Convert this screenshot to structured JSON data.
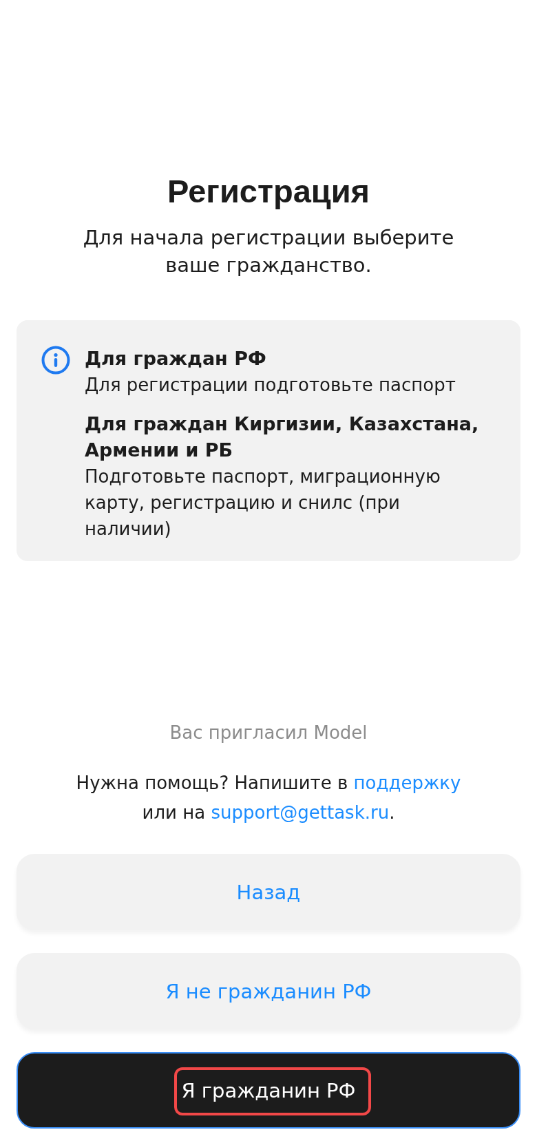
{
  "header": {
    "title": "Регистрация",
    "subtitle": "Для начала регистрации выберите ваше гражданство."
  },
  "info_card": {
    "sections": [
      {
        "heading": "Для граждан РФ",
        "text": "Для регистрации подготовьте паспорт"
      },
      {
        "heading": "Для граждан Киргизии, Казахстана, Армении и РБ",
        "text": "Подготовьте паспорт, миграционную карту, регистрацию и снилс (при наличии)"
      }
    ]
  },
  "invite_text": "Вас пригласил Model",
  "help": {
    "text_before": "Нужна помощь? Напишите в",
    "support_link": "поддержку",
    "text_middle": "или на",
    "email_link": "support@gettask.ru",
    "text_after": "."
  },
  "buttons": [
    {
      "label": "Назад",
      "kind": "secondary",
      "highlighted": false
    },
    {
      "label": "Я не гражданин РФ",
      "kind": "secondary",
      "highlighted": false
    },
    {
      "label": "Я гражданин РФ",
      "kind": "primary",
      "highlighted": true
    }
  ]
}
